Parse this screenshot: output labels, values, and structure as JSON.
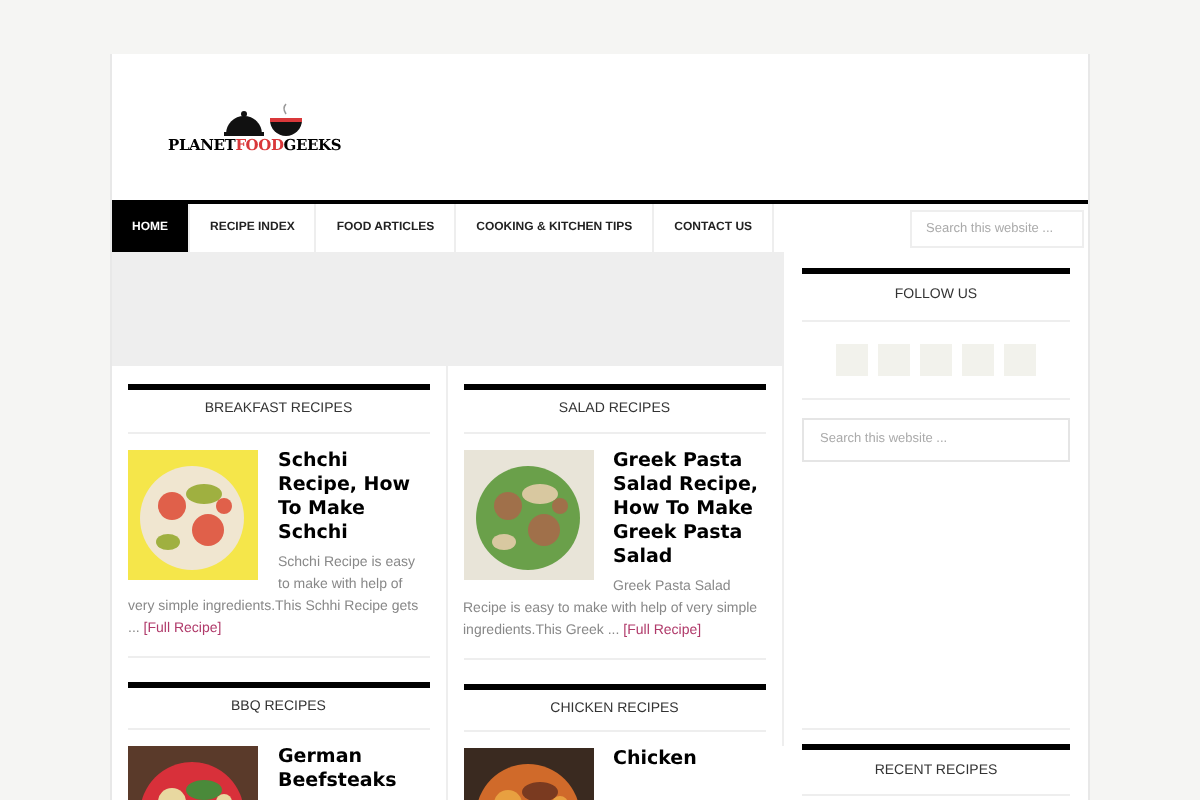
{
  "logo": {
    "before": "PLANET",
    "accent": "FOOD",
    "after": "GEEKS"
  },
  "nav": [
    {
      "label": "HOME",
      "selected": true
    },
    {
      "label": "RECIPE INDEX",
      "selected": false
    },
    {
      "label": "FOOD ARTICLES",
      "selected": false
    },
    {
      "label": "COOKING & KITCHEN TIPS",
      "selected": false
    },
    {
      "label": "CONTACT US",
      "selected": false
    }
  ],
  "nav_search": {
    "placeholder": "Search this website ..."
  },
  "columns": [
    [
      {
        "title": "BREAKFAST RECIPES",
        "post": {
          "title": "Schchi Recipe, How To Make Schchi",
          "excerpt": "Schchi Recipe is easy to make with help of very simple ingredients.This Schhi Recipe gets ...",
          "link": "[Full Recipe]",
          "kind": "picture"
        }
      },
      {
        "title": "BBQ RECIPES",
        "post": {
          "title": "German Beefsteaks",
          "kind": "picture"
        }
      }
    ],
    [
      {
        "title": "SALAD RECIPES",
        "post": {
          "title": "Greek Pasta Salad Recipe, How To Make Greek Pasta Salad",
          "excerpt": "Greek Pasta Salad Recipe is easy to make with help of very simple ingredients.This Greek ...",
          "link": "[Full Recipe]",
          "kind": "picture"
        }
      },
      {
        "title": "CHICKEN RECIPES",
        "post": {
          "title": "Chicken",
          "kind": "picture"
        }
      }
    ]
  ],
  "sidebar": {
    "follow_title": "FOLLOW US",
    "search": {
      "placeholder": "Search this website ..."
    },
    "recent_title": "RECENT RECIPES"
  }
}
